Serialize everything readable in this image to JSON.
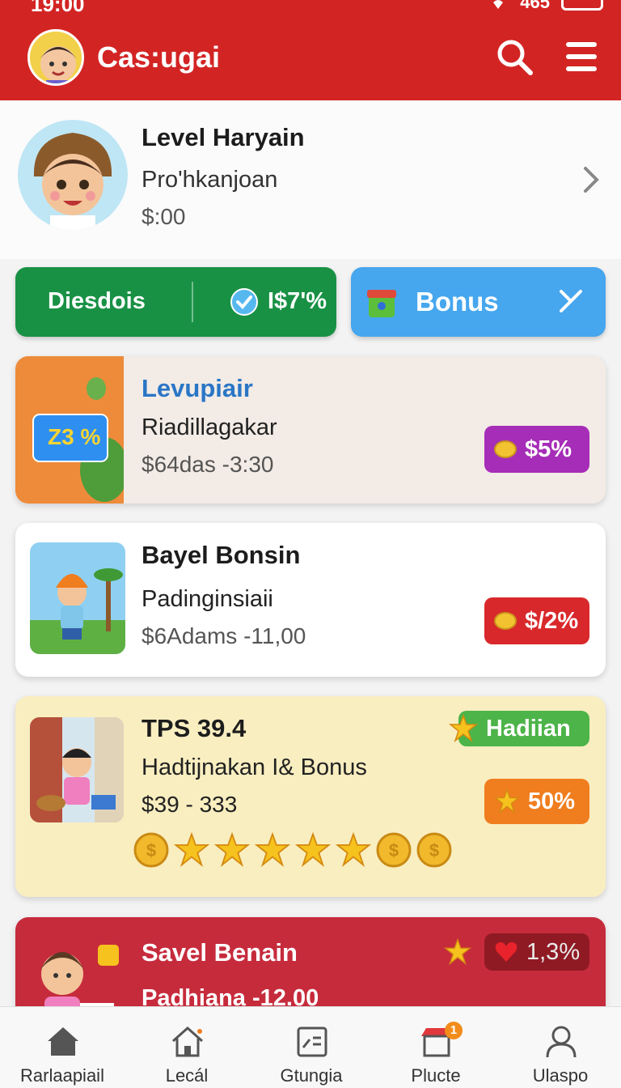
{
  "status_bar": {
    "time": "19:00",
    "signal": "465"
  },
  "header": {
    "app_title": "Cas:ugai"
  },
  "profile": {
    "name": "Level Haryain",
    "subtitle": "Pro'hkanjoan",
    "amount": "$:00"
  },
  "actions": {
    "green": {
      "label": "Diesdois",
      "value": "I$7'%"
    },
    "blue": {
      "label": "Bonus"
    }
  },
  "cards": [
    {
      "title": "Levupiair",
      "subtitle": "Riadillagakar",
      "price": "$64das -3:30",
      "thumb_text": "Z3 %",
      "badge": "$5%"
    },
    {
      "title": "Bayel Bonsin",
      "subtitle": "Padinginsiaii",
      "price": "$6Adams -11,00",
      "badge": "$/2%"
    },
    {
      "title": "TPS 39.4",
      "subtitle": "Hadtijnakan I& Bonus",
      "price": "$39 - 333",
      "tag": "Hadiian",
      "badge": "50%"
    },
    {
      "title": "Savel Benain",
      "subtitle": "Padhiana -12.00",
      "badge": "1,3%"
    }
  ],
  "nav": {
    "items": [
      {
        "label": "Rarlaapiail"
      },
      {
        "label": "Lecál"
      },
      {
        "label": "Gtungia"
      },
      {
        "label": "Plucte",
        "badge": "1"
      },
      {
        "label": "Ulaspo"
      }
    ]
  },
  "colors": {
    "header": "#d32424",
    "green": "#199145",
    "blue": "#46a6ee",
    "purple": "#a62db7",
    "red_badge": "#d9282b",
    "orange": "#f07d1e"
  }
}
